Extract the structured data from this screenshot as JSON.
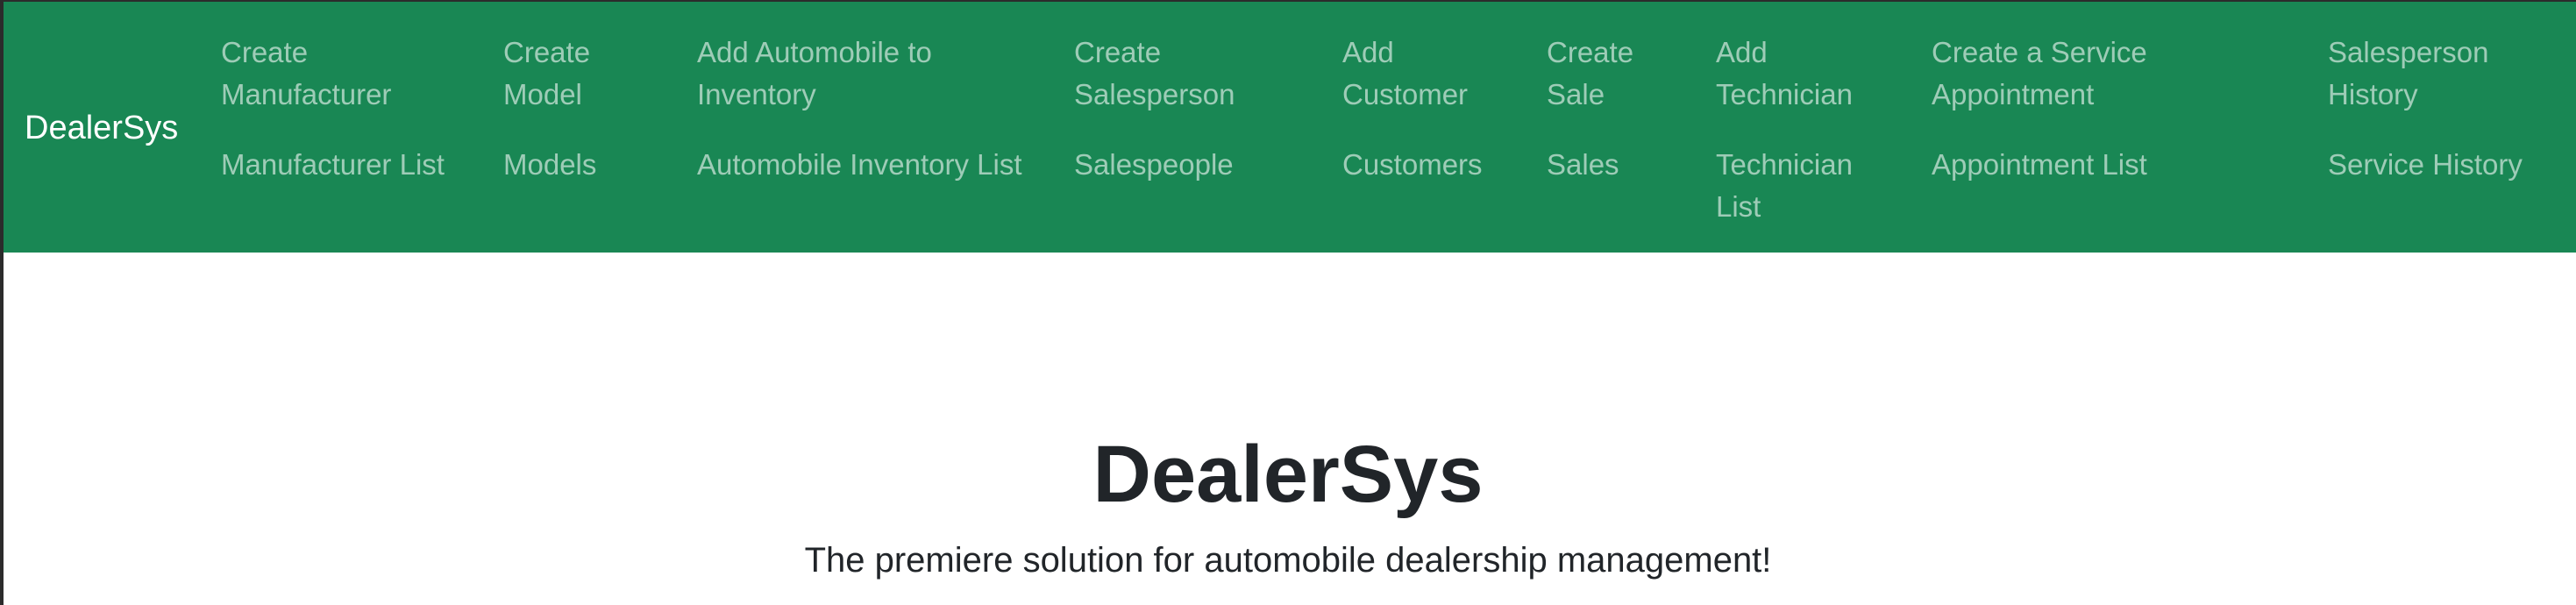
{
  "navbar": {
    "brand": "DealerSys",
    "row1": [
      "Create Manufacturer",
      "Create Model",
      "Add Automobile to Inventory",
      "Create Salesperson",
      "Add Customer",
      "Create Sale",
      "Add Technician",
      "Create a Service Appointment",
      "Salesperson History"
    ],
    "row2": [
      "Manufacturer List",
      "Models",
      "Automobile Inventory List",
      "Salespeople",
      "Customers",
      "Sales",
      "Technician List",
      "Appointment List",
      "Service History"
    ]
  },
  "main": {
    "title": "DealerSys",
    "lead": "The premiere solution for automobile dealership management!"
  },
  "colors": {
    "navbar_bg": "#198754",
    "brand_text": "#ffffff",
    "nav_link_text": "rgba(255,255,255,0.58)",
    "heading_text": "#212529"
  }
}
